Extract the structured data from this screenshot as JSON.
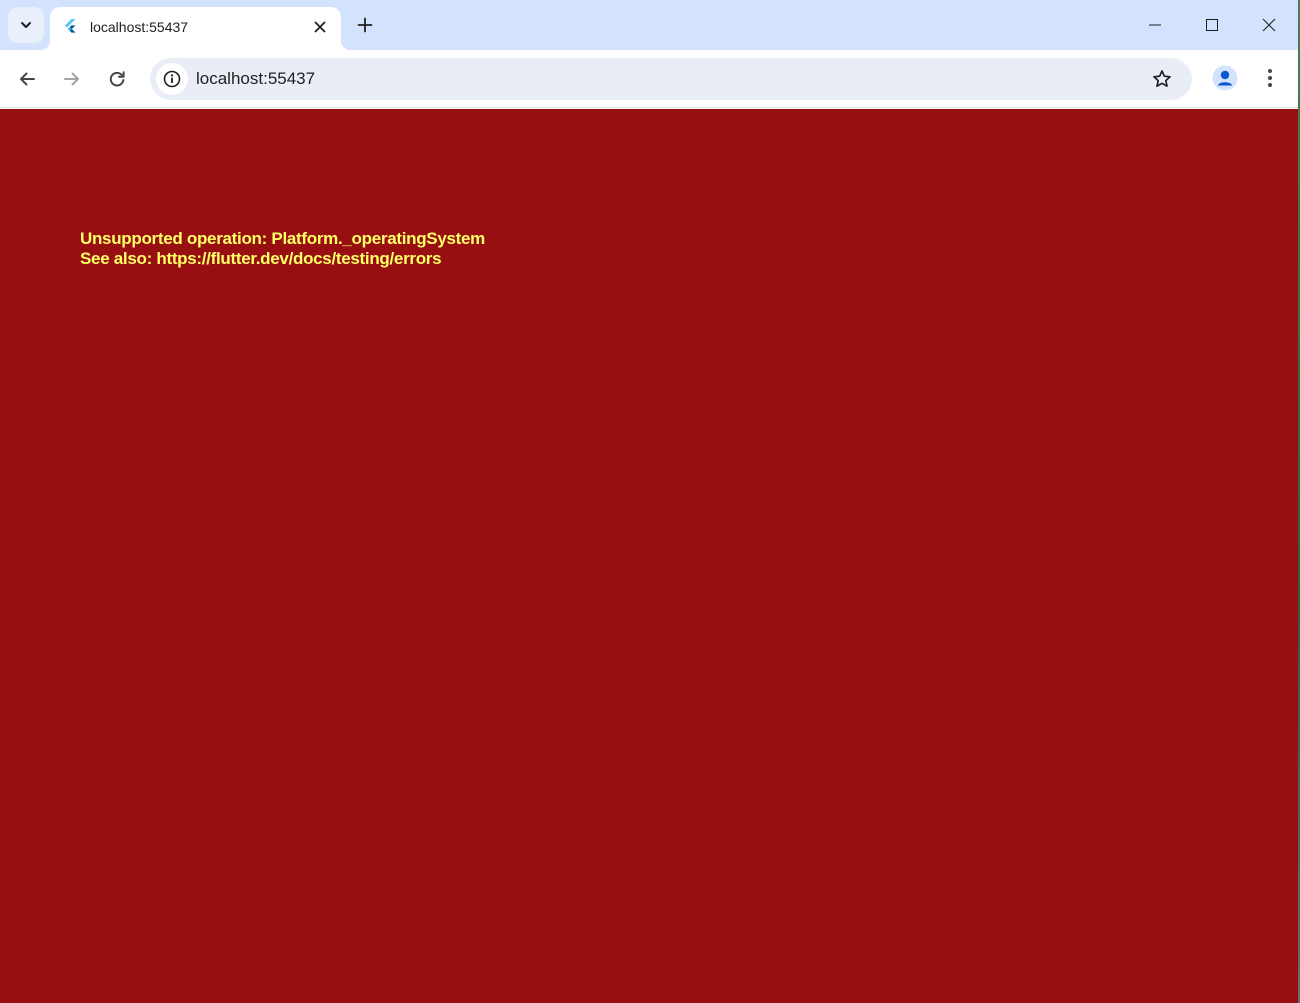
{
  "browser": {
    "tab": {
      "title": "localhost:55437",
      "favicon": "flutter-logo-icon"
    },
    "address_bar": {
      "url": "localhost:55437"
    },
    "icons": {
      "tab_search": "chevron-down-icon",
      "tab_close": "close-icon",
      "new_tab": "plus-icon",
      "minimize": "minimize-icon",
      "maximize": "maximize-icon",
      "close_window": "close-icon",
      "back": "arrow-left-icon",
      "forward": "arrow-right-icon",
      "reload": "reload-icon",
      "site_info": "info-icon",
      "bookmark": "star-icon",
      "profile": "person-icon",
      "menu": "vertical-dots-icon"
    },
    "colors": {
      "tabstrip": "#d3e3fd",
      "omnibox": "#e9eef6"
    }
  },
  "page": {
    "error_lines": [
      "Unsupported operation: Platform._operatingSystem",
      "See also: https://flutter.dev/docs/testing/errors"
    ],
    "colors": {
      "background": "#970f10",
      "text": "#ffff66"
    }
  }
}
